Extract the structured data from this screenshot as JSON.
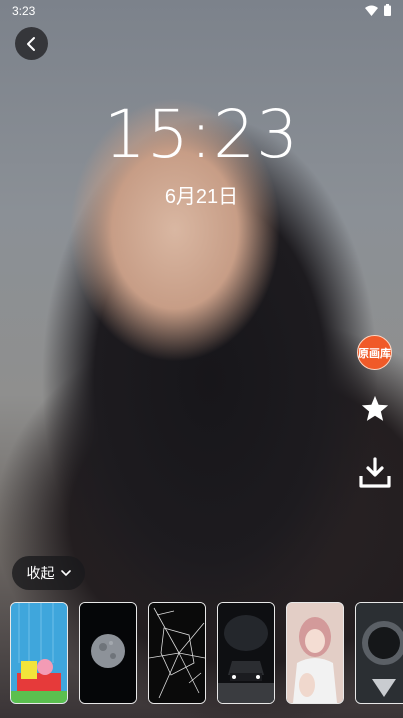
{
  "status_bar": {
    "time": "3:23",
    "wifi_icon": "wifi-icon",
    "battery_icon": "battery-icon"
  },
  "header": {
    "back_icon": "chevron-left-icon"
  },
  "lockscreen": {
    "clock": "15:23",
    "date": "6月21日"
  },
  "side_actions": {
    "brand_label": "原画库",
    "favorite_icon": "star-icon",
    "download_icon": "download-icon"
  },
  "collapse_button": {
    "label": "收起",
    "icon": "chevron-down-icon"
  },
  "thumbnails": [
    {
      "name": "spongebob-wallpaper"
    },
    {
      "name": "moon-wallpaper"
    },
    {
      "name": "cracked-glass-wallpaper"
    },
    {
      "name": "car-wallpaper"
    },
    {
      "name": "girl-wallpaper"
    },
    {
      "name": "astronaut-wallpaper"
    }
  ]
}
